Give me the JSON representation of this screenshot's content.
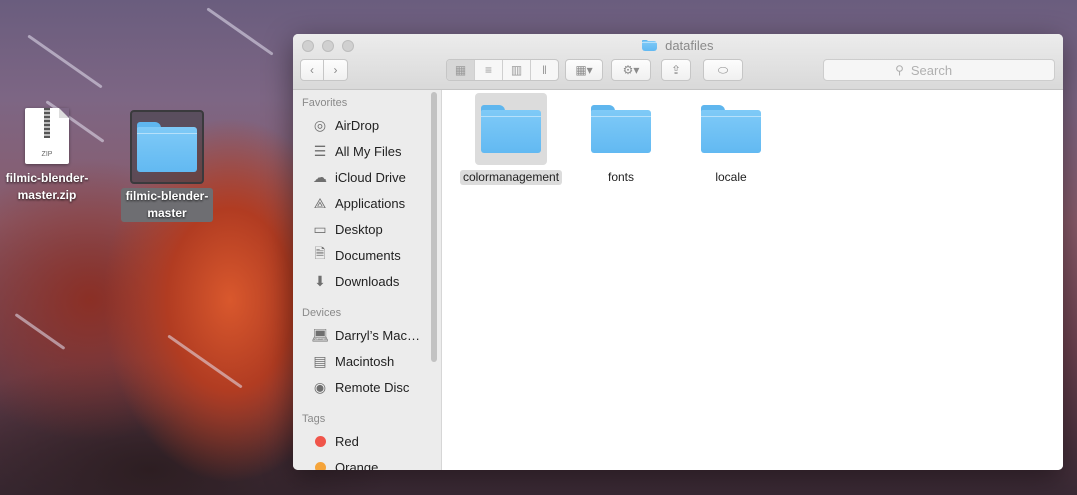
{
  "desktop": {
    "items": [
      {
        "label": "filmic-blender-master.zip",
        "file_badge": "ZIP"
      },
      {
        "label": "filmic-blender-master"
      }
    ]
  },
  "window": {
    "title": "datafiles",
    "search_placeholder": "Search"
  },
  "sidebar": {
    "favorites_header": "Favorites",
    "favorites": [
      {
        "label": "AirDrop",
        "icon": "airdrop-icon"
      },
      {
        "label": "All My Files",
        "icon": "all-my-files-icon"
      },
      {
        "label": "iCloud Drive",
        "icon": "cloud-icon"
      },
      {
        "label": "Applications",
        "icon": "applications-icon"
      },
      {
        "label": "Desktop",
        "icon": "desktop-icon"
      },
      {
        "label": "Documents",
        "icon": "document-icon"
      },
      {
        "label": "Downloads",
        "icon": "download-icon"
      }
    ],
    "devices_header": "Devices",
    "devices": [
      {
        "label": "Darryl’s Mac…",
        "icon": "laptop-icon"
      },
      {
        "label": "Macintosh",
        "icon": "hard-drive-icon"
      },
      {
        "label": "Remote Disc",
        "icon": "disc-icon"
      }
    ],
    "tags_header": "Tags",
    "tags": [
      {
        "label": "Red",
        "color": "#f0554a"
      },
      {
        "label": "Orange",
        "color": "#f5a43a"
      }
    ]
  },
  "content": {
    "items": [
      {
        "label": "colormanagement",
        "selected": true
      },
      {
        "label": "fonts",
        "selected": false
      },
      {
        "label": "locale",
        "selected": false
      }
    ]
  },
  "colors": {
    "folder": "#62b9f2",
    "selection": "#dcdcdc"
  }
}
